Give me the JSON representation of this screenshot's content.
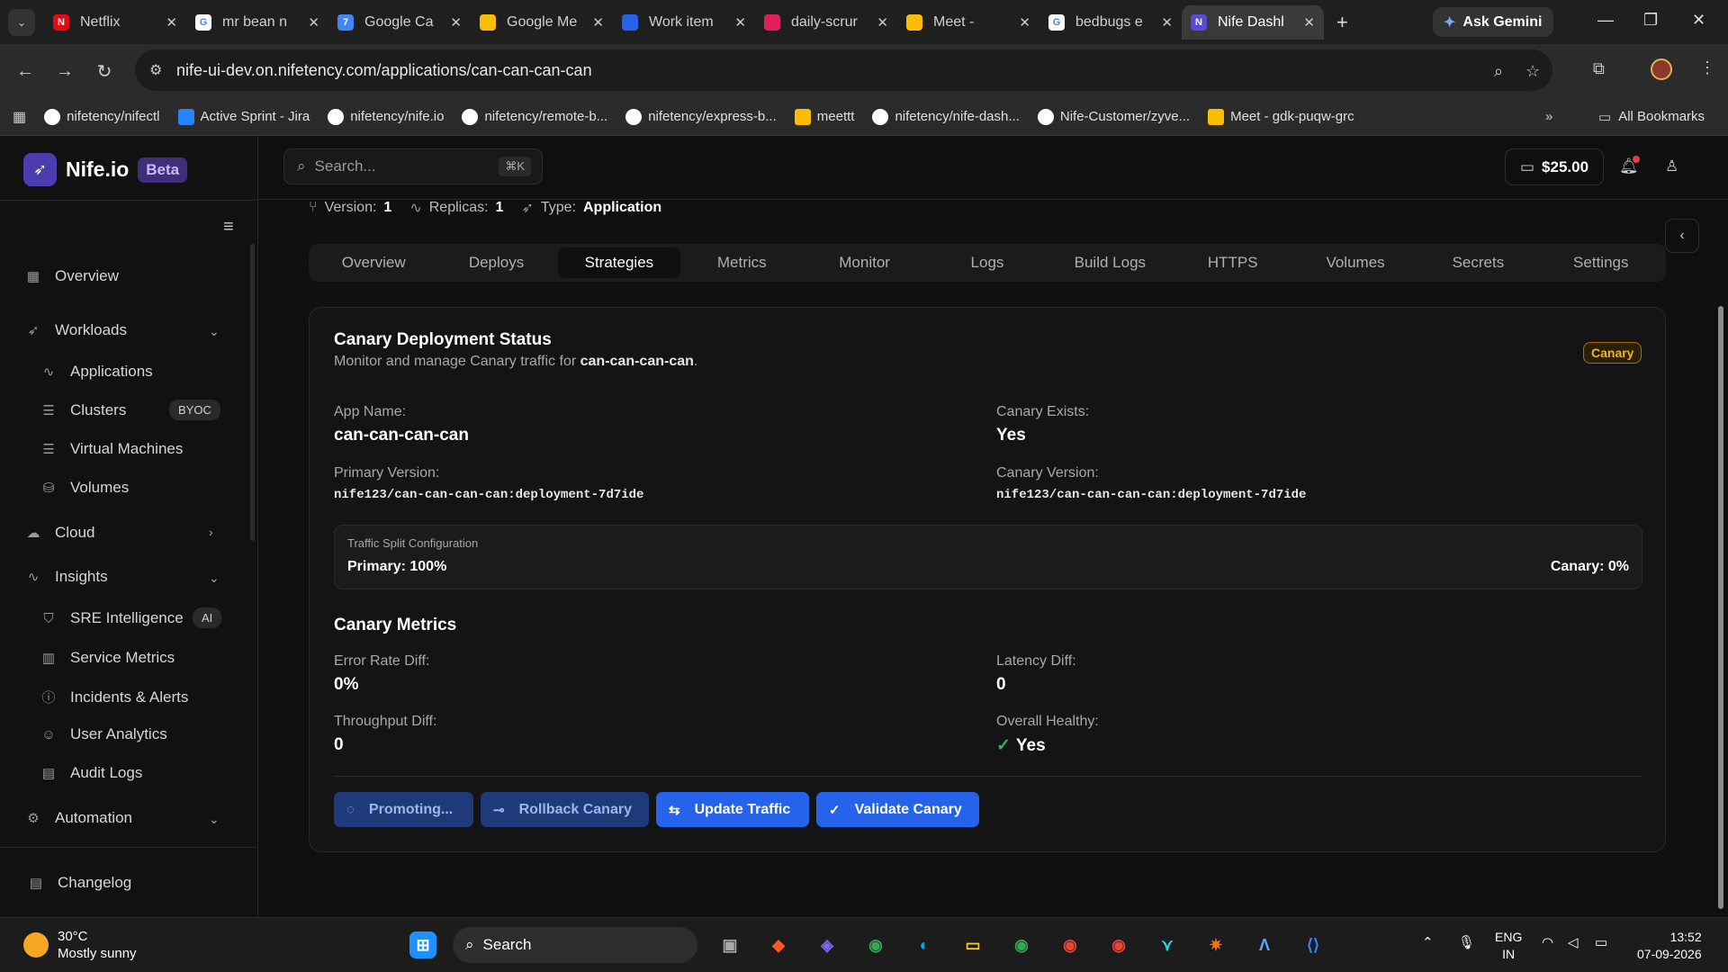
{
  "browser": {
    "tabs": [
      {
        "title": "Netflix",
        "color": "#e50914",
        "glyph": "N"
      },
      {
        "title": "mr bean n",
        "color": "#ffffff",
        "glyph": "G"
      },
      {
        "title": "Google Ca",
        "color": "#4285f4",
        "glyph": "7"
      },
      {
        "title": "Google Me",
        "color": "#fbbc04",
        "glyph": ""
      },
      {
        "title": "Work item",
        "color": "#2563eb",
        "glyph": ""
      },
      {
        "title": "daily-scrur",
        "color": "#e01e5a",
        "glyph": ""
      },
      {
        "title": "Meet -",
        "color": "#fbbc04",
        "glyph": ""
      },
      {
        "title": "bedbugs e",
        "color": "#ffffff",
        "glyph": "G"
      },
      {
        "title": "Nife Dashl",
        "color": "#5b4bd4",
        "glyph": "N"
      }
    ],
    "gemini_label": "Ask Gemini",
    "url": "nife-ui-dev.on.nifetency.com/applications/can-can-can-can",
    "bookmarks": [
      "nifetency/nifectl",
      "Active Sprint - Jira",
      "nifetency/nife.io",
      "nifetency/remote-b...",
      "nifetency/express-b...",
      "meettt",
      "nifetency/nife-dash...",
      "Nife-Customer/zyve...",
      "Meet - gdk-puqw-grc"
    ],
    "all_bookmarks": "All Bookmarks"
  },
  "sidebar": {
    "brand": "Nife.io",
    "beta": "Beta",
    "overview": "Overview",
    "workloads": "Workloads",
    "applications": "Applications",
    "clusters": "Clusters",
    "clusters_badge": "BYOC",
    "virtual_machines": "Virtual Machines",
    "volumes": "Volumes",
    "cloud": "Cloud",
    "insights": "Insights",
    "sre": "SRE Intelligence",
    "sre_badge": "AI",
    "service_metrics": "Service Metrics",
    "incidents": "Incidents & Alerts",
    "user_analytics": "User Analytics",
    "audit_logs": "Audit Logs",
    "automation": "Automation",
    "changelog": "Changelog"
  },
  "topbar": {
    "search_placeholder": "Search...",
    "search_kbd": "⌘K",
    "balance": "$25.00"
  },
  "meta": {
    "version_label": "Version:",
    "version": "1",
    "replicas_label": "Replicas:",
    "replicas": "1",
    "type_label": "Type:",
    "type": "Application"
  },
  "tabs": [
    "Overview",
    "Deploys",
    "Strategies",
    "Metrics",
    "Monitor",
    "Logs",
    "Build Logs",
    "HTTPS",
    "Volumes",
    "Secrets",
    "Settings"
  ],
  "active_tab": "Strategies",
  "canary": {
    "title": "Canary Deployment Status",
    "subtitle_prefix": "Monitor and manage Canary traffic for",
    "subtitle_app": "can-can-can-can",
    "subtitle_suffix": ".",
    "badge": "Canary",
    "app_name_label": "App Name:",
    "app_name": "can-can-can-can",
    "canary_exists_label": "Canary Exists:",
    "canary_exists": "Yes",
    "primary_version_label": "Primary Version:",
    "primary_version": "nife123/can-can-can-can:deployment-7d7ide",
    "canary_version_label": "Canary Version:",
    "canary_version": "nife123/can-can-can-can:deployment-7d7ide",
    "traffic_label": "Traffic Split Configuration",
    "traffic_primary": "Primary: 100%",
    "traffic_canary": "Canary: 0%",
    "metrics_title": "Canary Metrics",
    "error_rate_label": "Error Rate Diff:",
    "error_rate": "0%",
    "latency_label": "Latency Diff:",
    "latency": "0",
    "throughput_label": "Throughput Diff:",
    "throughput": "0",
    "healthy_label": "Overall Healthy:",
    "healthy": "Yes",
    "btn_promoting": "Promoting...",
    "btn_rollback": "Rollback Canary",
    "btn_update": "Update Traffic",
    "btn_validate": "Validate Canary"
  },
  "taskbar": {
    "temp": "30°C",
    "condition": "Mostly sunny",
    "search": "Search",
    "lang1": "ENG",
    "lang2": "IN",
    "time": "13:52",
    "date": "07-09-2026"
  }
}
